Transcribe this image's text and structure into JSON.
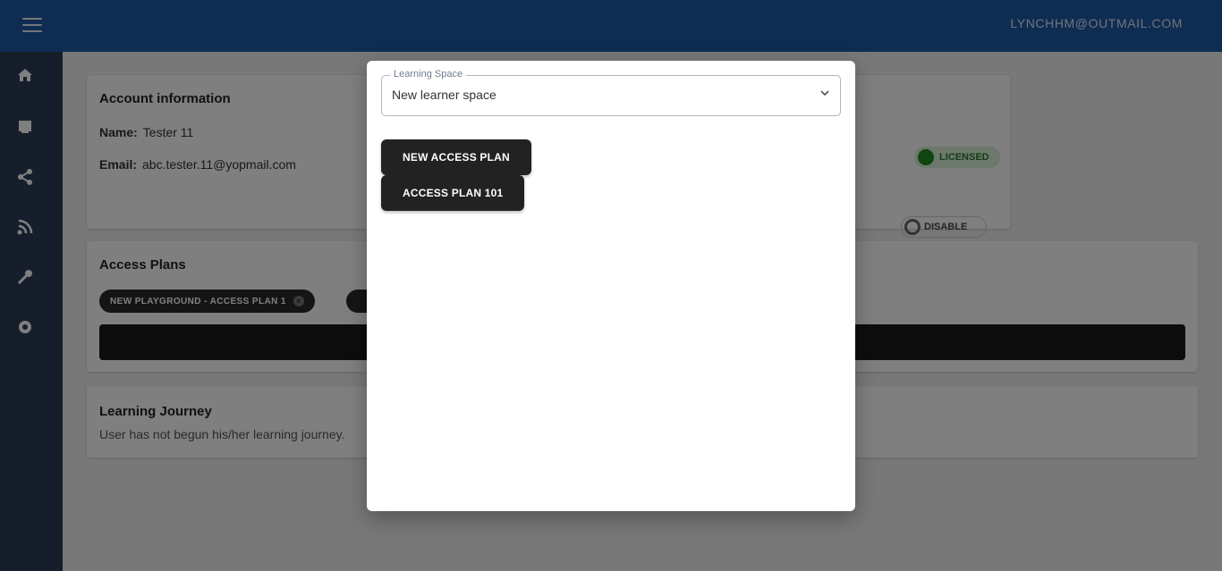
{
  "header": {
    "user_email": "LYNCHHM@OUTMAIL.COM"
  },
  "sidebar": {
    "items": [
      {
        "icon": "home-icon",
        "glyph": "⌂"
      },
      {
        "icon": "book-icon",
        "glyph": "▤"
      },
      {
        "icon": "share-icon",
        "glyph": "⟨"
      },
      {
        "icon": "feed-icon",
        "glyph": "◔"
      },
      {
        "icon": "wrench-icon",
        "glyph": "✎"
      },
      {
        "icon": "gear-icon",
        "glyph": "⚙"
      }
    ]
  },
  "account": {
    "title": "Account information",
    "name_label": "Name:",
    "name_value": "Tester 11",
    "email_label": "Email:",
    "email_value": "abc.tester.11@yopmail.com",
    "status": "LICENSED",
    "toggle_label": "DISABLE"
  },
  "access_plans": {
    "title": "Access Plans",
    "chips": [
      "NEW PLAYGROUND - ACCESS PLAN 1",
      ""
    ]
  },
  "learning_journey": {
    "title": "Learning Journey",
    "text": "User has not begun his/her learning journey."
  },
  "dialog": {
    "select_label": "Learning Space",
    "select_value": "New learner space",
    "buttons": [
      "NEW ACCESS PLAN",
      "ACCESS PLAN 101"
    ]
  },
  "colors": {
    "topbar": "#1e5ba6",
    "sidebar": "#2f3d57",
    "button_dark": "#222222"
  }
}
